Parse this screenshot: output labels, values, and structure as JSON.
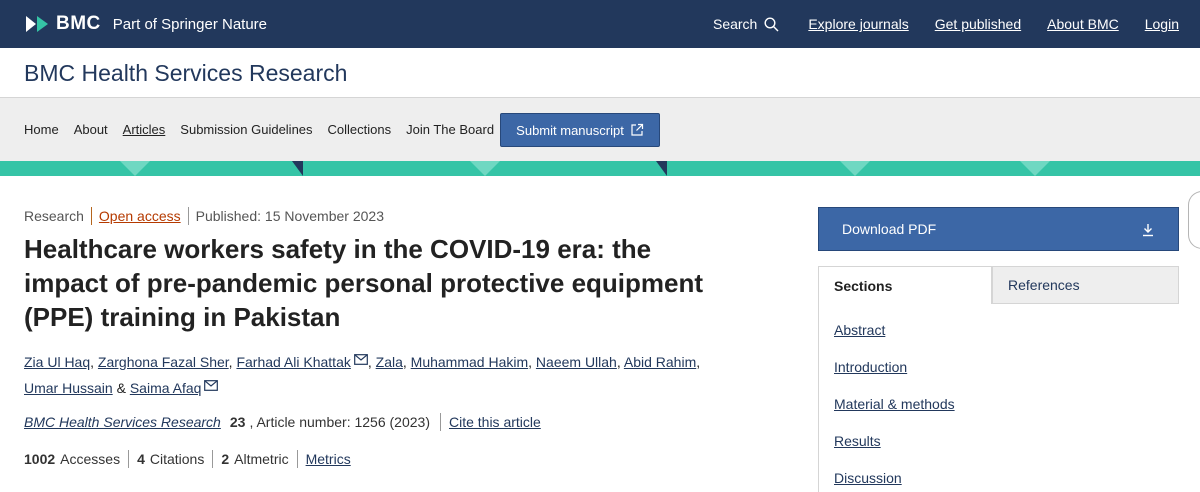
{
  "topbar": {
    "brand": "BMC",
    "publisher": "Part of Springer Nature",
    "search_label": "Search",
    "links": [
      "Explore journals",
      "Get published",
      "About BMC",
      "Login"
    ]
  },
  "journal": {
    "title": "BMC Health Services Research"
  },
  "nav": {
    "items": [
      "Home",
      "About",
      "Articles",
      "Submission Guidelines",
      "Collections",
      "Join The Board"
    ],
    "submit_label": "Submit manuscript"
  },
  "article": {
    "type": "Research",
    "access": "Open access",
    "published": "Published: 15 November 2023",
    "title": "Healthcare workers safety in the COVID-19 era: the impact of pre-pandemic personal protective equipment (PPE) training in Pakistan",
    "authors": [
      "Zia Ul Haq",
      "Zarghona Fazal Sher",
      "Farhad Ali Khattak",
      "Zala",
      "Muhammad Hakim",
      "Naeem Ullah",
      "Abid Rahim",
      "Umar Hussain",
      "Saima Afaq"
    ],
    "author_sep": ",",
    "author_and": "&",
    "citation": {
      "journal": "BMC Health Services Research",
      "volume": "23",
      "article_number": ", Article number: 1256 (2023)",
      "cite_label": "Cite this article"
    },
    "metrics": {
      "accesses": "1002",
      "accesses_label": "Accesses",
      "citations": "4",
      "citations_label": "Citations",
      "altmetric": "2",
      "altmetric_label": "Altmetric",
      "metrics_label": "Metrics"
    }
  },
  "sidebar": {
    "download_label": "Download PDF",
    "tabs": [
      "Sections",
      "References"
    ],
    "sections": [
      "Abstract",
      "Introduction",
      "Material & methods",
      "Results",
      "Discussion"
    ]
  },
  "colors": {
    "header_bg": "#22385c",
    "button_blue": "#3c67a6",
    "accent_teal": "#35c4a6",
    "open_access": "#b53a00"
  },
  "icons": [
    "bmc-logo-icon",
    "search-icon",
    "external-link-icon",
    "email-icon",
    "download-icon"
  ]
}
